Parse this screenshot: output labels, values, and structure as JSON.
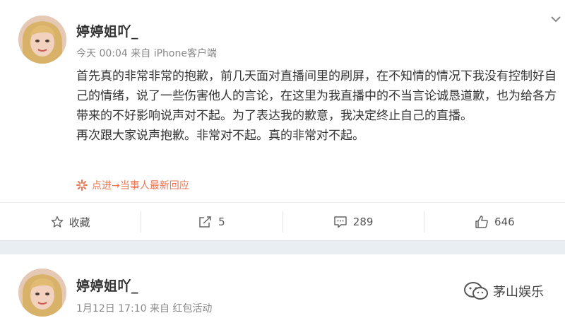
{
  "post1": {
    "username": "婷婷姐吖_",
    "meta": "今天 00:04 来自 iPhone客户端",
    "paragraphs": [
      "首先真的非常非常的抱歉，前几天面对直播间里的刷屏，在不知情的情况下我没有控制好自己的情绪，说了一些伤害他人的言论，在这里为我直播中的不当言论诚恳道歉，也为给各方带来的不好影响说声对不起。为了表达我的歉意，我决定终止自己的直播。",
      "再次跟大家说声抱歉。非常对不起。真的非常对不起。"
    ],
    "reply_link": "点进→当事人最新回应",
    "actions": {
      "favorite": "收藏",
      "repost": "5",
      "comment": "289",
      "like": "646"
    }
  },
  "post2": {
    "username": "婷婷姐吖_",
    "meta": "1月12日 17:10 来自 红包活动"
  },
  "watermark": "茅山娱乐",
  "colors": {
    "link": "#eb7350",
    "divider_band": "#e9eef3"
  }
}
